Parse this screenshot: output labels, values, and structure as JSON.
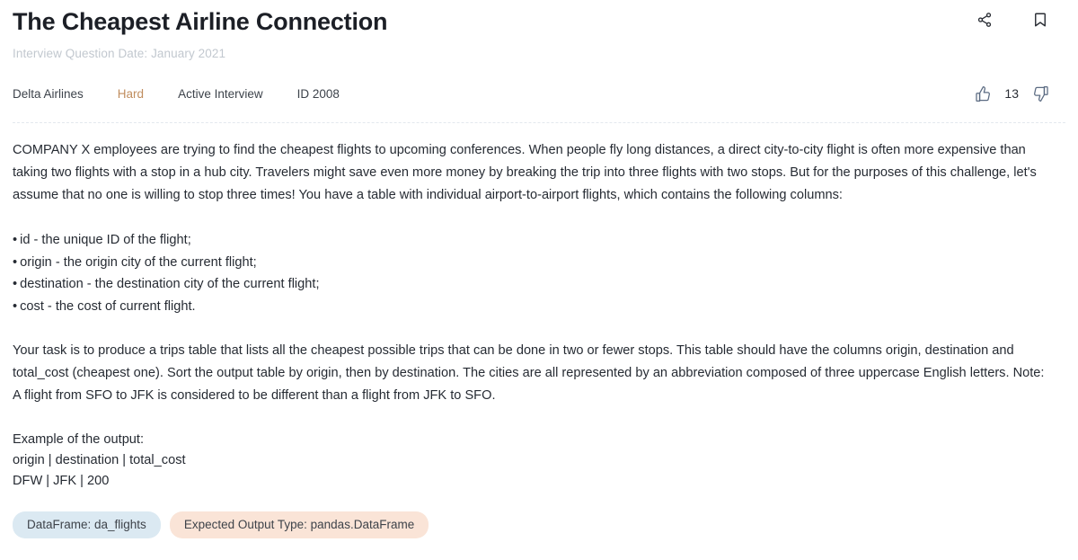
{
  "header": {
    "title": "The Cheapest Airline Connection",
    "subtitle": "Interview Question Date: January 2021",
    "icons": {
      "share": "share-icon",
      "bookmark": "bookmark-icon"
    }
  },
  "meta": {
    "company": "Delta Airlines",
    "difficulty": "Hard",
    "difficulty_color": "#c08d5e",
    "status": "Active Interview",
    "question_id": "ID 2008",
    "votes": {
      "upvote_icon": "thumbs-up-icon",
      "count": "13",
      "downvote_icon": "thumbs-down-icon"
    }
  },
  "body": {
    "intro": "COMPANY X employees are trying to find the cheapest flights to upcoming conferences. When people fly long distances, a direct city-to-city flight is often more expensive than taking two flights with a stop in a hub city. Travelers might save even more money by breaking the trip into three flights with two stops. But for the purposes of this challenge, let's assume that no one is willing to stop three times! You have a table with individual airport-to-airport flights, which contains the following columns:",
    "bullets": [
      "id - the unique ID of the flight;",
      "origin - the origin city of the current flight;",
      "destination - the destination city of the current flight;",
      "cost - the cost of current flight."
    ],
    "bullet_marker": "•",
    "task": "Your task is to produce a trips table that lists all the cheapest possible trips that can be done in two or fewer stops. This table should have the columns origin, destination and total_cost (cheapest one). Sort the output table by origin, then by destination. The cities are all represented by an abbreviation composed of three uppercase English letters. Note: A flight from SFO to JFK is considered to be different than a flight from JFK to SFO.",
    "example_heading": "Example of the output:",
    "example_header_row": "origin | destination | total_cost",
    "example_data_row": "DFW | JFK | 200"
  },
  "chips": {
    "dataframe": "DataFrame: da_flights",
    "dataframe_color": "#dbe9f2",
    "output_type": "Expected Output Type: pandas.DataFrame",
    "output_type_color": "#fae4d7"
  }
}
